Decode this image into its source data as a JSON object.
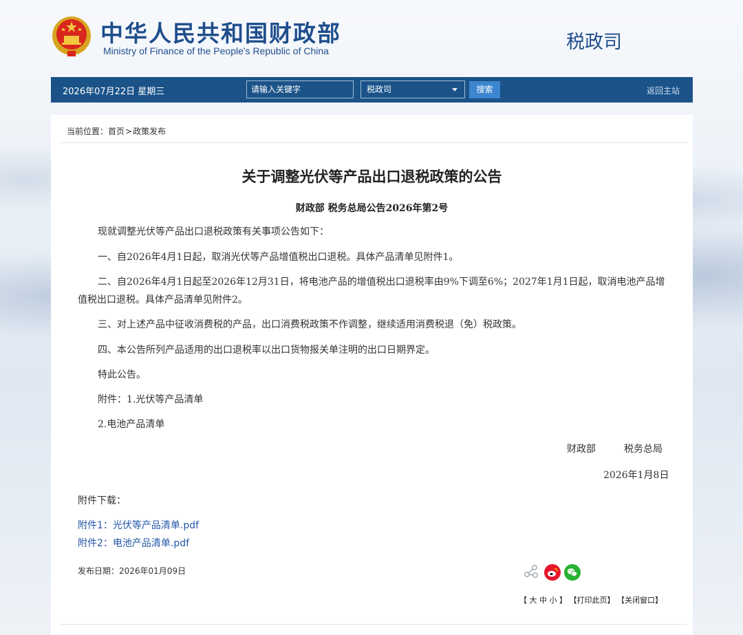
{
  "header": {
    "cn_title": "中华人民共和国财政部",
    "en_title": "Ministry of Finance of the People's Republic of China",
    "dept": "税政司"
  },
  "nav": {
    "date": "2026年07月22日  星期三",
    "search_placeholder": "请输入关键字",
    "select_value": "税政司",
    "search_label": "搜索",
    "home_label": "返回主站"
  },
  "breadcrumb": {
    "prefix": "当前位置：",
    "home": "首页",
    "sep": ">",
    "current": "政策发布"
  },
  "article": {
    "title": "关于调整光伏等产品出口退税政策的公告",
    "subtitle": "财政部  税务总局公告2026年第2号",
    "paragraphs": [
      "现就调整光伏等产品出口退税政策有关事项公告如下：",
      "一、自2026年4月1日起，取消光伏等产品增值税出口退税。具体产品清单见附件1。",
      "二、自2026年4月1日起至2026年12月31日，将电池产品的增值税出口退税率由9%下调至6%；2027年1月1日起，取消电池产品增值税出口退税。具体产品清单见附件2。",
      "三、对上述产品中征收消费税的产品，出口消费税政策不作调整，继续适用消费税退（免）税政策。",
      "四、本公告所列产品适用的出口退税率以出口货物报关单注明的出口日期界定。",
      "特此公告。",
      "附件：1.光伏等产品清单",
      "2.电池产品清单"
    ],
    "sign_org1": "财政部",
    "sign_org2": "税务总局",
    "sign_date": "2026年1月8日"
  },
  "downloads": {
    "title": "附件下载：",
    "items": [
      "附件1：光伏等产品清单.pdf",
      "附件2：电池产品清单.pdf"
    ]
  },
  "footer": {
    "pub_date": "发布日期：2026年01月09日",
    "font_label_open": "【",
    "font_large": "大",
    "font_medium": "中",
    "font_small": "小",
    "font_label_close": "】",
    "print": "【打印此页】",
    "close": "【关闭窗口】"
  },
  "colors": {
    "brand_blue": "#1f4e8c",
    "nav_bar": "#1b5389",
    "search_button": "#3c86cf",
    "link": "#2557a7",
    "weibo": "#e6162d",
    "wechat": "#28b232"
  },
  "icons": {
    "emblem": "national-emblem",
    "share": "share-icon",
    "weibo": "weibo-icon",
    "wechat": "wechat-icon",
    "dropdown": "chevron-down-icon"
  }
}
